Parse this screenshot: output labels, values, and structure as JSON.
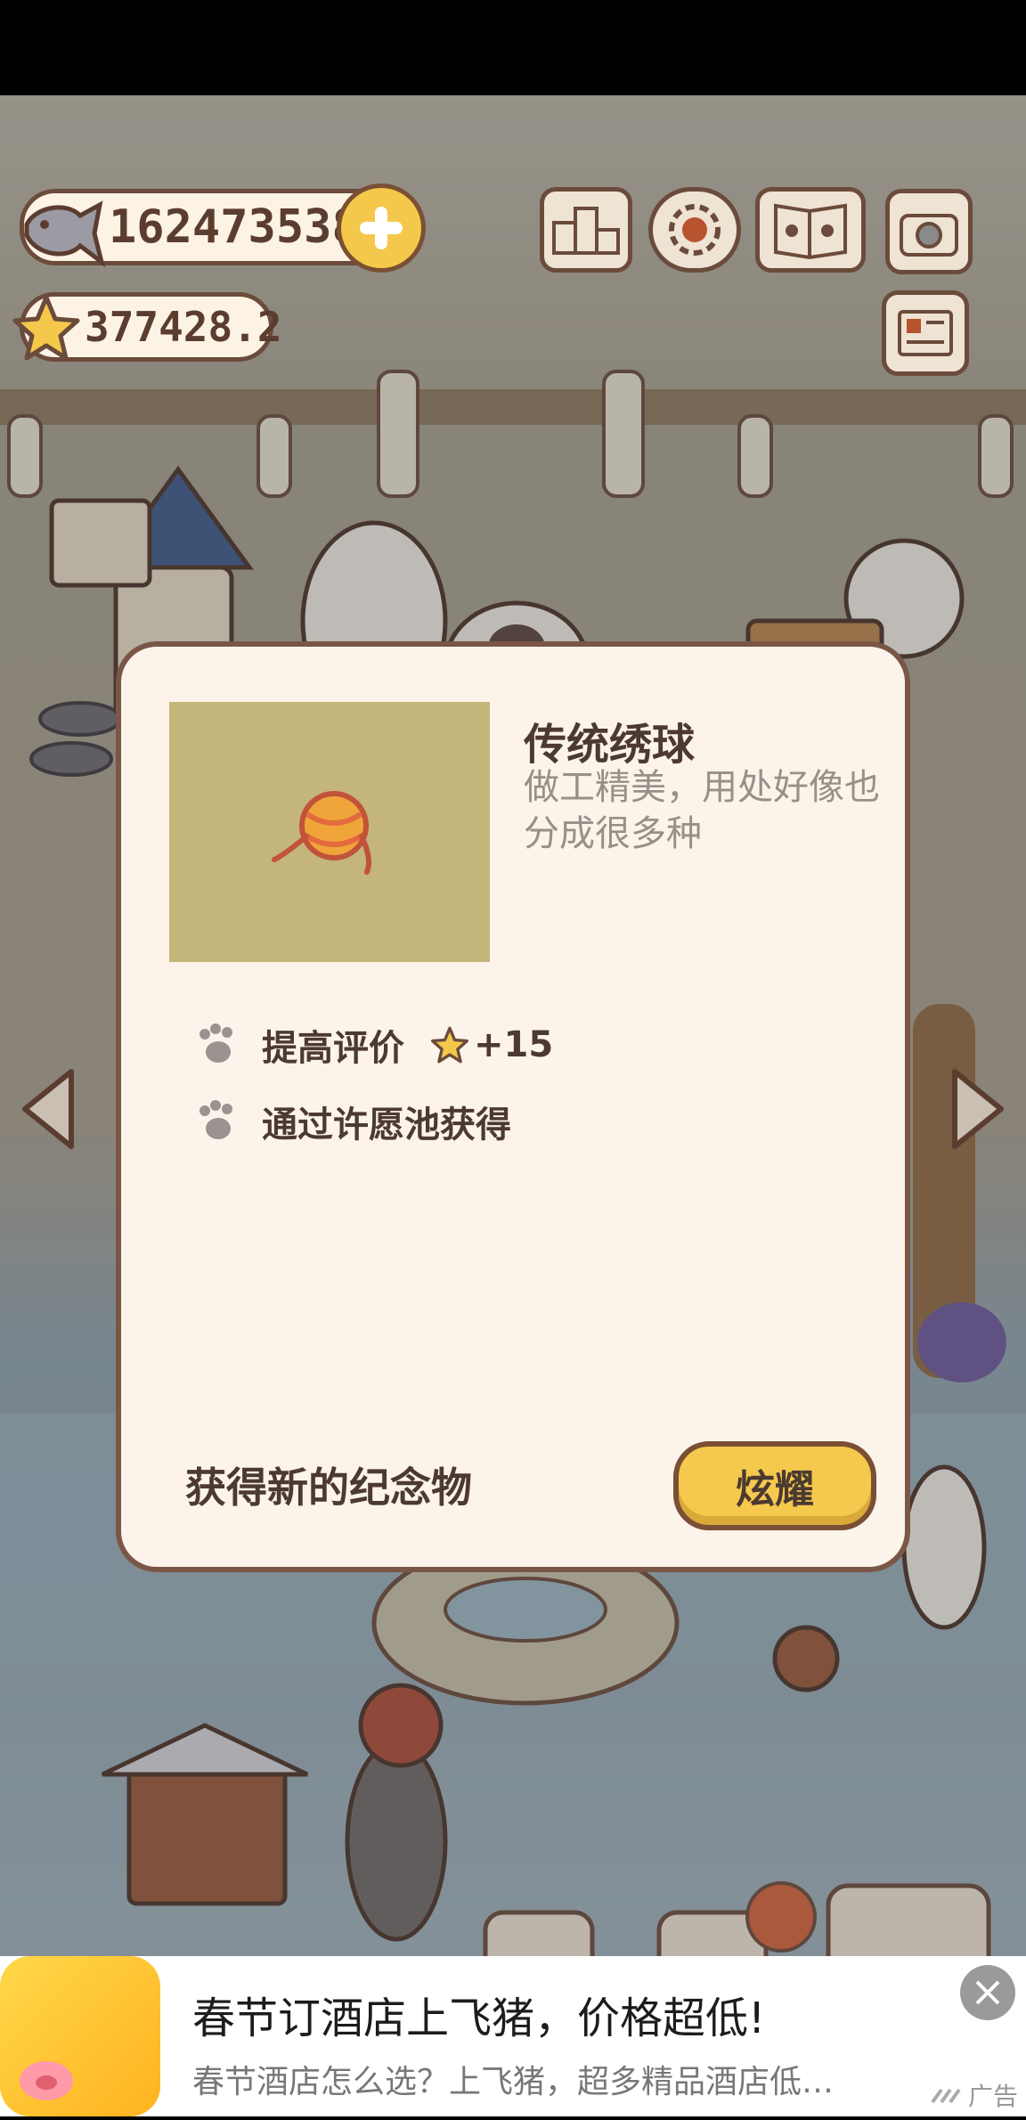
{
  "hud": {
    "fish_count": "162473538",
    "star_rating": "377428.2"
  },
  "toolbar": {
    "icons": [
      "ranking-icon",
      "settings-gear-icon",
      "paw-book-icon",
      "camera-icon",
      "newspaper-icon"
    ]
  },
  "modal": {
    "item_name": "传统绣球",
    "item_description": "做工精美，用处好像也分成很多种",
    "stats": [
      {
        "label": "提高评价",
        "bonus": "+15"
      },
      {
        "label": "通过许愿池获得"
      }
    ],
    "footer_text": "获得新的纪念物",
    "share_button": "炫耀"
  },
  "ad": {
    "title": "春节订酒店上飞猪，价格超低!",
    "subtitle": "春节酒店怎么选？上飞猪，超多精品酒店低…",
    "mark": "广告"
  },
  "colors": {
    "modal_bg": "#fcf4ea",
    "accent_yellow": "#f5c94d",
    "outline_brown": "#7a5646"
  }
}
